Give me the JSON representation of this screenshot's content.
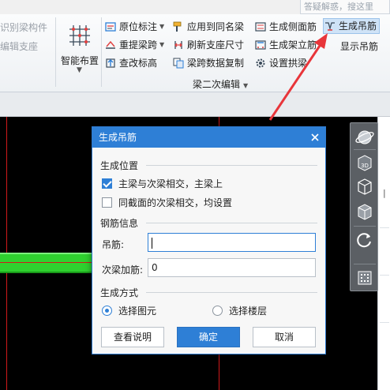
{
  "search": {
    "placeholder": "答疑解惑，搜这里"
  },
  "ribbon": {
    "left_items": [
      "识别梁构件",
      "编辑支座"
    ],
    "smart_layout": {
      "label": "智能布置"
    },
    "col1": [
      "原位标注",
      "重提梁跨",
      "查改标高"
    ],
    "col2": [
      "应用到同名梁",
      "刷新支座尺寸",
      "梁跨数据复制"
    ],
    "col3": [
      "生成侧面筋",
      "生成架立筋",
      "设置拱梁"
    ],
    "col4": [
      "生成吊筋",
      "显示吊筋"
    ],
    "group_label": "梁二次编辑"
  },
  "dialog": {
    "title": "生成吊筋",
    "position_section": "生成位置",
    "option1": {
      "label": "主梁与次梁相交，主梁上",
      "checked": true
    },
    "option2": {
      "label": "同截面的次梁相交，均设置",
      "checked": false
    },
    "rebar_section": "钢筋信息",
    "hanger_label": "吊筋:",
    "hanger_value": "",
    "secondary_label": "次梁加筋:",
    "secondary_value": "0",
    "method_section": "生成方式",
    "radio1": {
      "label": "选择图元",
      "selected": true
    },
    "radio2": {
      "label": "选择楼层",
      "selected": false
    },
    "buttons": {
      "help": "查看说明",
      "ok": "确定",
      "cancel": "取消"
    }
  },
  "colors": {
    "accent": "#2e7fd6",
    "canvas": "#000000",
    "beam": "#2fd12f",
    "axis_line": "#d0191b",
    "annotation_arrow": "#e8353a"
  }
}
